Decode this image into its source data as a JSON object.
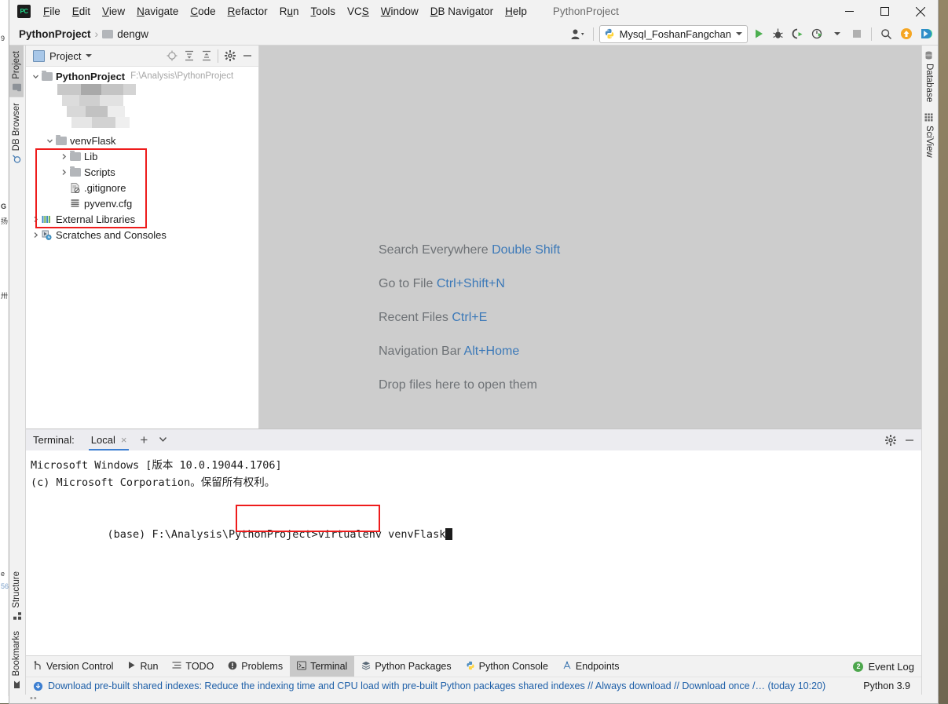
{
  "window": {
    "app_title": "PythonProject",
    "logo_text": "PC",
    "minimize": "minimize-window",
    "maximize": "maximize-window",
    "close": "close-window"
  },
  "menu": {
    "items": [
      {
        "label": "File"
      },
      {
        "label": "Edit"
      },
      {
        "label": "View"
      },
      {
        "label": "Navigate"
      },
      {
        "label": "Code"
      },
      {
        "label": "Refactor"
      },
      {
        "label": "Run"
      },
      {
        "label": "Tools"
      },
      {
        "label": "VCS"
      },
      {
        "label": "Window"
      },
      {
        "label": "DB Navigator"
      },
      {
        "label": "Help"
      }
    ]
  },
  "navbar": {
    "crumb_project": "PythonProject",
    "crumb_sep": "›",
    "crumb_file": "dengw",
    "run_config": "Mysql_FoshanFangchan",
    "icons": {
      "account": "account-icon",
      "run": "run-icon",
      "debug": "debug-icon",
      "coverage": "run-coverage-icon",
      "profile": "profile-icon",
      "stop": "stop-icon",
      "search": "search-icon",
      "update": "update-icon",
      "feature_trainer": "feature-trainer-icon"
    }
  },
  "left_strip": {
    "top": [
      {
        "label": "Project",
        "icon": "project-folder-icon",
        "active": true
      },
      {
        "label": "DB Browser",
        "icon": "db-browser-icon",
        "active": false
      }
    ],
    "bottom": [
      {
        "label": "Structure",
        "icon": "structure-icon",
        "active": false
      },
      {
        "label": "Bookmarks",
        "icon": "bookmark-icon",
        "active": false
      }
    ]
  },
  "right_strip": {
    "top": [
      {
        "label": "Database",
        "icon": "database-icon",
        "active": false
      },
      {
        "label": "SciView",
        "icon": "sciview-icon",
        "active": false
      }
    ]
  },
  "project_panel": {
    "title": "Project",
    "toolbar_icons": [
      {
        "name": "select-opened-file-icon"
      },
      {
        "name": "expand-all-icon"
      },
      {
        "name": "collapse-all-icon"
      },
      {
        "name": "settings-gear-icon"
      },
      {
        "name": "hide-panel-icon"
      }
    ],
    "tree": [
      {
        "label": "PythonProject",
        "path": "F:\\Analysis\\PythonProject",
        "indent": 0,
        "arrow": "down",
        "icon": "folder-icon",
        "bold": true
      },
      {
        "label": "venvFlask",
        "path": "",
        "indent": 1,
        "arrow": "down",
        "icon": "folder-icon",
        "bold": false
      },
      {
        "label": "Lib",
        "path": "",
        "indent": 2,
        "arrow": "right",
        "icon": "folder-icon",
        "bold": false
      },
      {
        "label": "Scripts",
        "path": "",
        "indent": 2,
        "arrow": "right",
        "icon": "folder-icon",
        "bold": false
      },
      {
        "label": ".gitignore",
        "path": "",
        "indent": 2,
        "arrow": "none",
        "icon": "gitignore-icon",
        "bold": false
      },
      {
        "label": "pyvenv.cfg",
        "path": "",
        "indent": 2,
        "arrow": "none",
        "icon": "config-file-icon",
        "bold": false
      },
      {
        "label": "External Libraries",
        "path": "",
        "indent": 0,
        "arrow": "right",
        "icon": "libraries-icon",
        "bold": false
      },
      {
        "label": "Scratches and Consoles",
        "path": "",
        "indent": 0,
        "arrow": "right",
        "icon": "scratches-icon",
        "bold": false
      }
    ],
    "highlight_color": "#ee1c1c"
  },
  "editor": {
    "hints": [
      {
        "action": "Search Everywhere",
        "shortcut": "Double Shift"
      },
      {
        "action": "Go to File",
        "shortcut": "Ctrl+Shift+N"
      },
      {
        "action": "Recent Files",
        "shortcut": "Ctrl+E"
      },
      {
        "action": "Navigation Bar",
        "shortcut": "Alt+Home"
      },
      {
        "action": "Drop files here to open them",
        "shortcut": ""
      }
    ]
  },
  "terminal": {
    "label": "Terminal:",
    "tab_name": "Local",
    "close_glyph": "×",
    "add_glyph": "+",
    "settings_icon": "settings-gear-icon",
    "hide_icon": "hide-panel-icon",
    "lines": [
      "Microsoft Windows [版本 10.0.19044.1706]",
      "(c) Microsoft Corporation。保留所有权利。",
      "",
      ""
    ],
    "prompt": "(base) F:\\Analysis\\PythonProject>",
    "command": "virtualenv venvFlask",
    "highlight_color": "#ee1c1c"
  },
  "bottom_bar": {
    "items": [
      {
        "label": "Version Control",
        "icon": "version-control-icon",
        "active": false
      },
      {
        "label": "Run",
        "icon": "run-icon",
        "active": false
      },
      {
        "label": "TODO",
        "icon": "todo-icon",
        "active": false
      },
      {
        "label": "Problems",
        "icon": "problems-icon",
        "active": false
      },
      {
        "label": "Terminal",
        "icon": "terminal-icon",
        "active": true
      },
      {
        "label": "Python Packages",
        "icon": "python-packages-icon",
        "active": false
      },
      {
        "label": "Python Console",
        "icon": "python-console-icon",
        "active": false
      },
      {
        "label": "Endpoints",
        "icon": "endpoints-icon",
        "active": false
      }
    ],
    "event_log": {
      "label": "Event Log",
      "count": "2"
    }
  },
  "status_bar": {
    "message": "Download pre-built shared indexes: Reduce the indexing time and CPU load with pre-built Python packages shared indexes // Always download // Download once /… (today 10:20)",
    "interpreter": "Python 3.9"
  }
}
